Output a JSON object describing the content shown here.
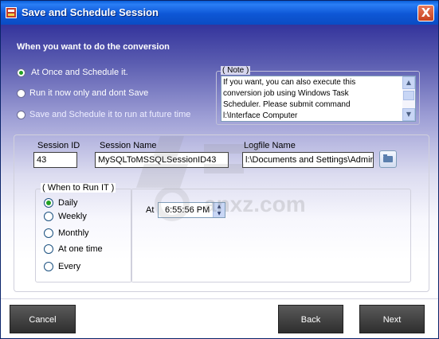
{
  "window": {
    "title": "Save and Schedule Session",
    "close_glyph": "X"
  },
  "heading": "When you want to do the conversion",
  "modes": [
    {
      "label": "At Once and Schedule it.",
      "selected": true
    },
    {
      "label": "Run it now only and dont Save",
      "selected": false
    },
    {
      "label": "Save and Schedule it to run at future time",
      "selected": false
    }
  ],
  "note": {
    "legend": "( Note )",
    "lines": [
      "If you want, you can also execute this",
      "conversion job using Windows Task",
      "Scheduler. Please submit command",
      "l:\\Interface Computer"
    ]
  },
  "session": {
    "id_label": "Session ID",
    "id_value": "43",
    "name_label": "Session Name",
    "name_value": "MySQLToMSSQLSessionID43",
    "log_label": "Logfile Name",
    "log_value": "l:\\Documents and Settings\\Admini"
  },
  "when_to_run": {
    "legend": "( When to Run IT )",
    "options": [
      {
        "label": "Daily",
        "selected": true
      },
      {
        "label": "Weekly",
        "selected": false
      },
      {
        "label": "Monthly",
        "selected": false
      },
      {
        "label": "At one time",
        "selected": false
      },
      {
        "label": "Every",
        "selected": false
      }
    ]
  },
  "time": {
    "label": "At",
    "value": "6:55:56 PM"
  },
  "buttons": {
    "cancel": "Cancel",
    "back": "Back",
    "next": "Next"
  },
  "watermark": "anxz.com",
  "colors": {
    "titlebar": "#0a5fd8",
    "selected_radio": "#21a121",
    "button_dark": "#3a3a3a"
  }
}
